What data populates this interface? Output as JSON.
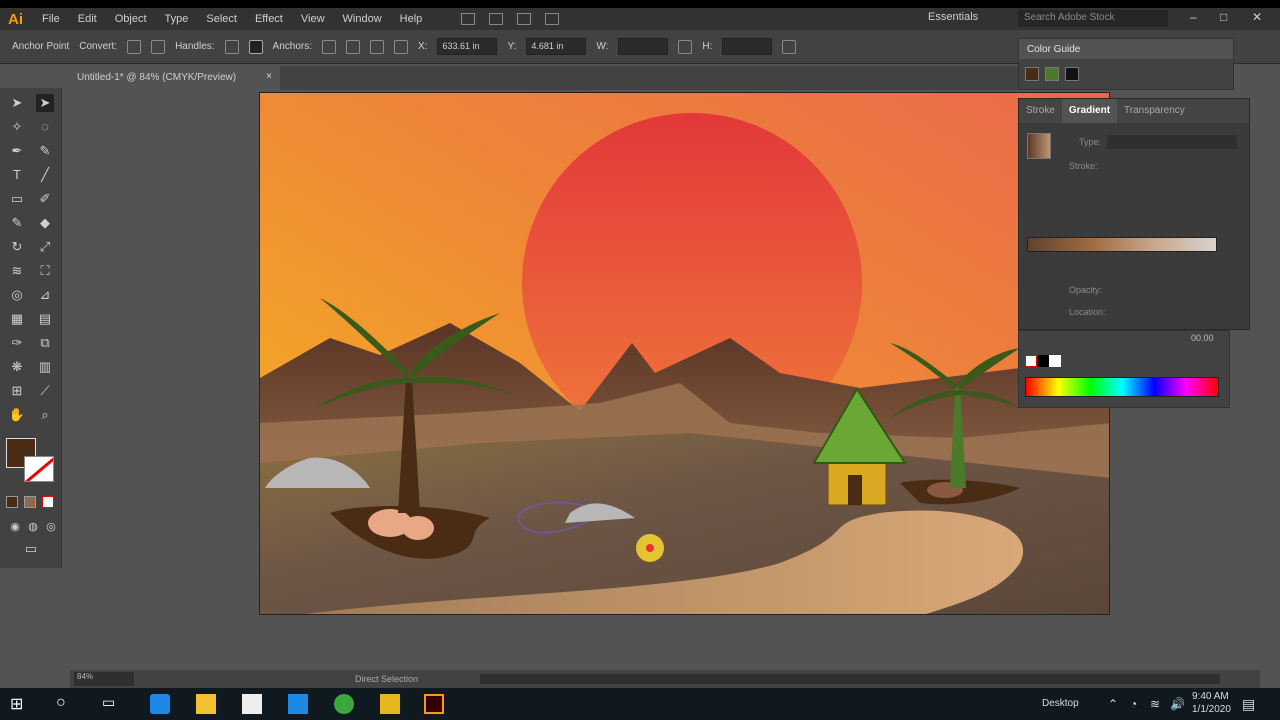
{
  "app": {
    "logo": "Ai",
    "brand_color": "#ff9a00",
    "menu": [
      "File",
      "Edit",
      "Object",
      "Type",
      "Select",
      "Effect",
      "View",
      "Window",
      "Help"
    ],
    "workspace": "Essentials",
    "search_placeholder": "Search Adobe Stock",
    "window_controls": [
      "minimize",
      "maximize",
      "close"
    ]
  },
  "control_bar": {
    "anchor_label": "Anchor Point",
    "convert_label": "Convert:",
    "handles_label": "Handles:",
    "anchors_label": "Anchors:",
    "x_label": "X:",
    "x_value": "633.61 in",
    "y_label": "Y:",
    "y_value": "4.681 in",
    "w_label": "W:",
    "h_label": "H:"
  },
  "document_tab": {
    "title": "Untitled-1* @ 84% (CMYK/Preview)",
    "close": "×"
  },
  "tools": {
    "fill_color": "#4a2b14",
    "stroke": "none"
  },
  "panels": {
    "color_guide_title": "Color Guide",
    "color_guide_swatches": [
      "#4a2b14",
      "#4a7a2a",
      "#111111"
    ],
    "gradient_tabs": [
      "Stroke",
      "Gradient",
      "Transparency"
    ],
    "gradient_type_label": "Type:",
    "gradient_stroke_label": "Stroke:",
    "gradient_opacity_label": "Opacity:",
    "gradient_location_label": "Location:",
    "color_value": "00.00"
  },
  "status": {
    "zoom": "84%",
    "label": "Direct Selection"
  },
  "taskbar": {
    "desktop_label": "Desktop",
    "time": "9:40 AM",
    "date": "1/1/2020"
  }
}
